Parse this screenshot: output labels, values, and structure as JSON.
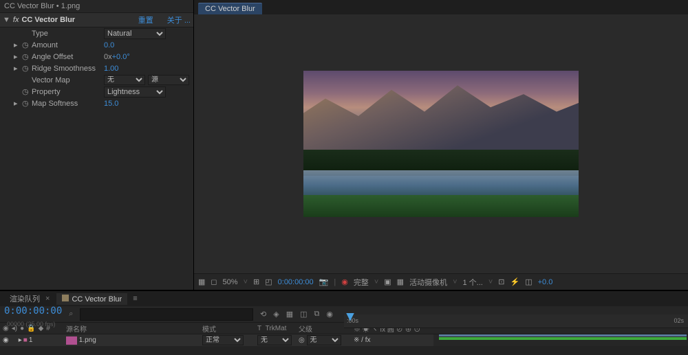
{
  "effects": {
    "header": "CC Vector Blur • 1.png",
    "fx_label": "fx",
    "effect_name": "CC Vector Blur",
    "reset_link": "重置",
    "about_link": "关于 ...",
    "props": {
      "type": {
        "label": "Type",
        "value": "Natural"
      },
      "amount": {
        "label": "Amount",
        "value": "0.0"
      },
      "angle_offset": {
        "label": "Angle Offset",
        "prefix": "0x",
        "value": "+0.0°"
      },
      "ridge_smoothness": {
        "label": "Ridge Smoothness",
        "value": "1.00"
      },
      "vector_map": {
        "label": "Vector Map",
        "sel1": "无",
        "sel2": "源"
      },
      "property": {
        "label": "Property",
        "value": "Lightness"
      },
      "map_softness": {
        "label": "Map Softness",
        "value": "15.0"
      }
    }
  },
  "viewer": {
    "tab": "CC Vector Blur",
    "controls": {
      "zoom": "50%",
      "timecode": "0:00:00:00",
      "resolution": "完整",
      "camera": "活动摄像机",
      "views": "1 个...",
      "exposure": "+0.0"
    }
  },
  "timeline": {
    "tab_queue": "渲染队列",
    "tab_comp": "CC Vector Blur",
    "timecode": "0:00:00:00",
    "fps": "00000 (25.00 fps)",
    "search_placeholder": "",
    "ticks": {
      "start": ":00s",
      "end": "02s"
    },
    "cols": {
      "num": "#",
      "source_name": "源名称",
      "mode": "模式",
      "trkmat": "TrkMat",
      "t": "T",
      "parent": "父级",
      "switches": "※ ☀ ヽ fx 圓 ⊘ ⊕ ⊙"
    },
    "layer": {
      "num": "1",
      "name": "1.png",
      "mode": "正常",
      "trkmat_val": "无",
      "parent": "无",
      "toggles": "※    / fx"
    }
  }
}
